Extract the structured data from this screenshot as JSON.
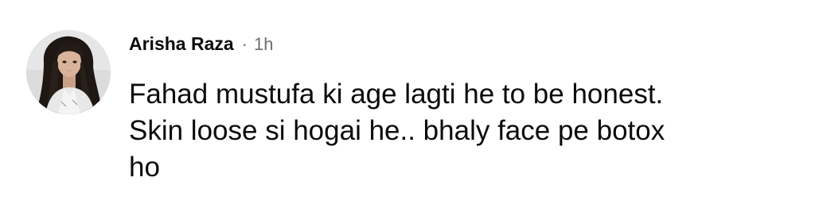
{
  "comment": {
    "author": "Arisha Raza",
    "separator": "·",
    "timestamp": "1h",
    "text_lines": [
      "Fahad mustufa ki age lagti he to be honest.",
      "Skin loose si hogai he.. bhaly face pe botox",
      "ho"
    ]
  }
}
